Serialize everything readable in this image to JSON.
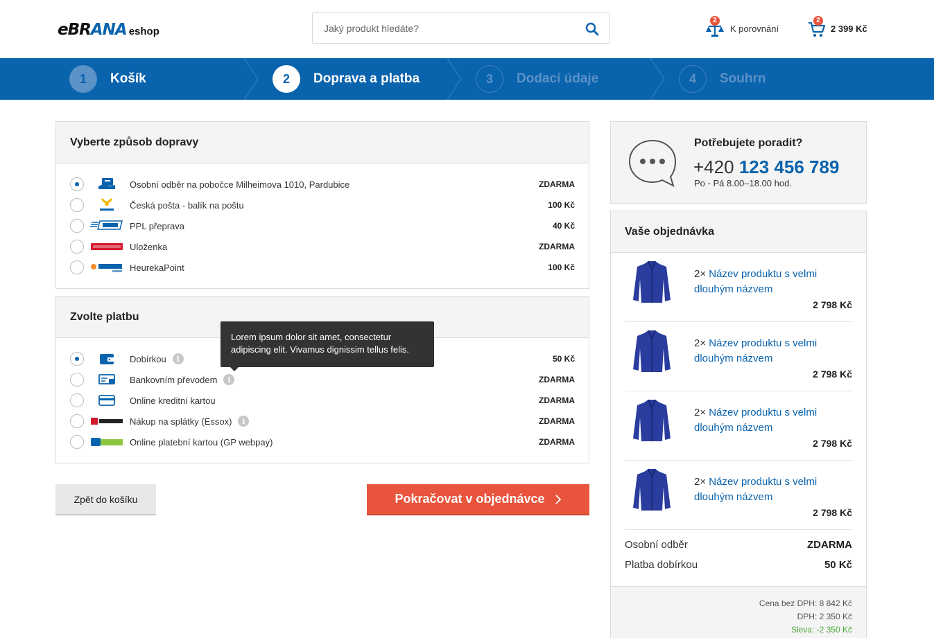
{
  "header": {
    "logo_brand_a": "eBR",
    "logo_brand_b": "ANA",
    "logo_suffix": "eshop",
    "search_placeholder": "Jaký produkt hledáte?",
    "compare_count": "2",
    "compare_label": "K porovnání",
    "cart_count": "2",
    "cart_total": "2 399 Kč"
  },
  "steps": [
    {
      "num": "1",
      "label": "Košík",
      "state": "done"
    },
    {
      "num": "2",
      "label": "Doprava a platba",
      "state": "active"
    },
    {
      "num": "3",
      "label": "Dodací údaje",
      "state": "future"
    },
    {
      "num": "4",
      "label": "Souhrn",
      "state": "future"
    }
  ],
  "shipping": {
    "title": "Vyberte způsob dopravy",
    "options": [
      {
        "label": "Osobní odběr na pobočce Milheimova 1010, Pardubice",
        "price": "ZDARMA",
        "logo": "store-pickup-icon",
        "selected": true
      },
      {
        "label": "Česká pošta - balík na poštu",
        "price": "100 Kč",
        "logo": "ceska-posta-logo",
        "selected": false
      },
      {
        "label": "PPL přeprava",
        "price": "40 Kč",
        "logo": "ppl-logo",
        "selected": false
      },
      {
        "label": "Uloženka",
        "price": "ZDARMA",
        "logo": "ulozenka-logo",
        "selected": false
      },
      {
        "label": "HeurekaPoint",
        "price": "100 Kč",
        "logo": "heurekapoint-logo",
        "selected": false
      }
    ]
  },
  "payment": {
    "title": "Zvolte platbu",
    "options": [
      {
        "label": "Dobírkou",
        "price": "50 Kč",
        "logo": "wallet-icon",
        "selected": true,
        "info": true
      },
      {
        "label": "Bankovním převodem",
        "price": "ZDARMA",
        "logo": "bank-transfer-icon",
        "selected": false,
        "info": true
      },
      {
        "label": "Online kreditní kartou",
        "price": "ZDARMA",
        "logo": "credit-card-icon",
        "selected": false,
        "info": false
      },
      {
        "label": "Nákup na splátky (Essox)",
        "price": "ZDARMA",
        "logo": "essox-logo",
        "selected": false,
        "info": true
      },
      {
        "label": "Online platební kartou (GP webpay)",
        "price": "ZDARMA",
        "logo": "gp-webpay-logo",
        "selected": false,
        "info": false
      }
    ],
    "tooltip": "Lorem ipsum dolor sit amet, consectetur adipiscing elit. Vivamus dignissim tellus felis."
  },
  "actions": {
    "back_label": "Zpět do košíku",
    "next_label": "Pokračovat v objednávce"
  },
  "help": {
    "title": "Potřebujete poradit?",
    "phone_prefix": "+420",
    "phone_number": "123 456 789",
    "hours": "Po - Pá 8.00–18.00 hod."
  },
  "order": {
    "title": "Vaše objednávka",
    "items": [
      {
        "qty": "2×",
        "name": "Název produktu s velmi dlouhým názvem",
        "price": "2 798 Kč"
      },
      {
        "qty": "2×",
        "name": "Název produktu s velmi dlouhým názvem",
        "price": "2 798 Kč"
      },
      {
        "qty": "2×",
        "name": "Název produktu s velmi dlouhým názvem",
        "price": "2 798 Kč"
      },
      {
        "qty": "2×",
        "name": "Název produktu s velmi dlouhým názvem",
        "price": "2 798 Kč"
      }
    ],
    "shipping_label": "Osobní odběr",
    "shipping_value": "ZDARMA",
    "payment_label": "Platba dobírkou",
    "payment_value": "50 Kč",
    "price_no_vat": "Cena bez DPH: 8 842 Kč",
    "vat": "DPH: 2 350 Kč",
    "discount": "Sleva: -2 350 Kč"
  },
  "colors": {
    "brand_blue": "#0a63ad",
    "cta_orange": "#e8543c",
    "discount_green": "#4caa3c"
  }
}
